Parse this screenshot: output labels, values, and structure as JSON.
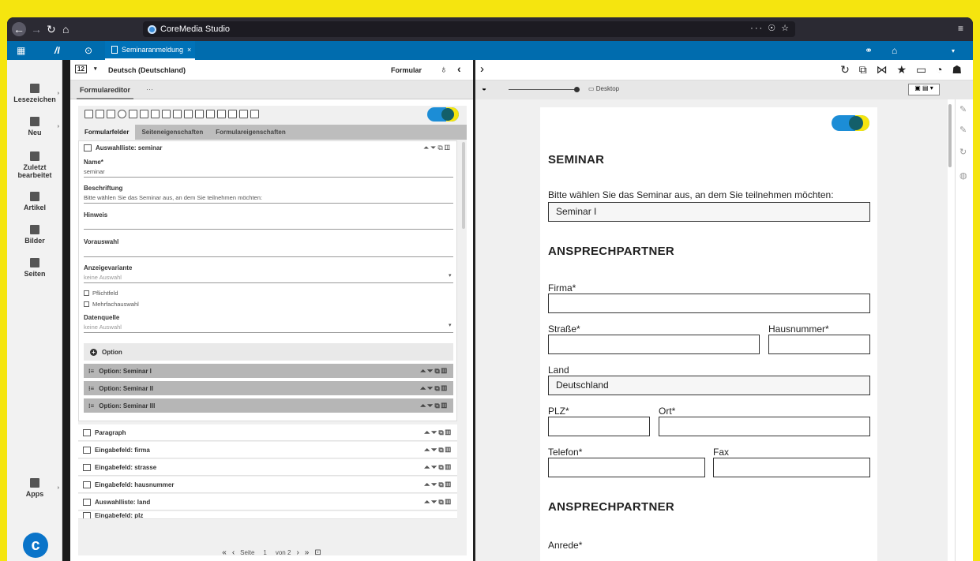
{
  "browser": {
    "tab_title": "CoreMedia Studio",
    "url_right_icons": "··· ☉ ☆",
    "menu_icon": "≡"
  },
  "appbar": {
    "open_tab": "Seminaranmeldung",
    "close": "×"
  },
  "sidebar": {
    "items": [
      {
        "label": "Lesezeichen"
      },
      {
        "label": "Neu"
      },
      {
        "label": "Zuletzt bearbeitet"
      },
      {
        "label": "Artikel"
      },
      {
        "label": "Bilder"
      },
      {
        "label": "Seiten"
      },
      {
        "label": "Apps"
      }
    ]
  },
  "left": {
    "locale": "Deutsch (Deutschland)",
    "view_mode": "Formular",
    "editor_tab": "Formulareditor",
    "more": "···",
    "subtabs": [
      "Formularfelder",
      "Seiteneigenschaften",
      "Formulareigenschaften"
    ],
    "panel_title": "Auswahlliste: seminar",
    "fields": {
      "name_label": "Name*",
      "name_value": "seminar",
      "caption_label": "Beschriftung",
      "caption_value": "Bitte wählen Sie das Seminar aus, an dem Sie teilnehmen möchten:",
      "hint_label": "Hinweis",
      "preset_label": "Vorauswahl",
      "variant_label": "Anzeigevariante",
      "variant_value": "keine Auswahl",
      "required": "Pflichtfeld",
      "multi": "Mehrfachauswahl",
      "source_label": "Datenquelle",
      "source_value": "keine Auswahl"
    },
    "option_button": "Option",
    "options": [
      "Option: Seminar I",
      "Option: Seminar II",
      "Option: Seminar III"
    ],
    "rows": [
      "Paragraph",
      "Eingabefeld: firma",
      "Eingabefeld: strasse",
      "Eingabefeld: hausnummer",
      "Auswahlliste: land",
      "Eingabefeld: plz"
    ],
    "pager": {
      "page_label": "Seite",
      "page": "1",
      "of": "von 2"
    }
  },
  "right": {
    "device": "Desktop",
    "preview": {
      "heading1": "SEMINAR",
      "question": "Bitte wählen Sie das Seminar aus, an dem Sie teilnehmen möchten:",
      "seminar_select": "Seminar I",
      "heading2": "ANSPRECHPARTNER",
      "firma": "Firma*",
      "strasse": "Straße*",
      "hausnummer": "Hausnummer*",
      "land": "Land",
      "land_value": "Deutschland",
      "plz": "PLZ*",
      "ort": "Ort*",
      "telefon": "Telefon*",
      "fax": "Fax",
      "heading3": "ANSPRECHPARTNER",
      "anrede": "Anrede*"
    }
  }
}
